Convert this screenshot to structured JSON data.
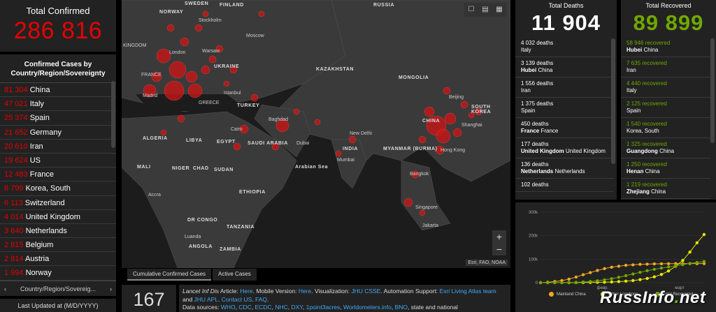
{
  "total_confirmed": {
    "label": "Total Confirmed",
    "value": "286 816"
  },
  "cases_list": {
    "header": "Confirmed Cases by Country/Region/Sovereignty",
    "items": [
      {
        "value": "81 304",
        "name": "China"
      },
      {
        "value": "47 021",
        "name": "Italy"
      },
      {
        "value": "25 374",
        "name": "Spain"
      },
      {
        "value": "21 652",
        "name": "Germany"
      },
      {
        "value": "20 610",
        "name": "Iran"
      },
      {
        "value": "19 624",
        "name": "US"
      },
      {
        "value": "12 483",
        "name": "France"
      },
      {
        "value": "8 799",
        "name": "Korea, South"
      },
      {
        "value": "6 113",
        "name": "Switzerland"
      },
      {
        "value": "4 014",
        "name": "United Kingdom"
      },
      {
        "value": "3 640",
        "name": "Netherlands"
      },
      {
        "value": "2 815",
        "name": "Belgium"
      },
      {
        "value": "2 814",
        "name": "Austria"
      },
      {
        "value": "1 994",
        "name": "Norway"
      }
    ],
    "footer": "Country/Region/Sovereig...",
    "prev_icon": "‹",
    "next_icon": "›"
  },
  "last_updated": "Last Updated at (M/D/YYYY)",
  "map": {
    "tools": [
      "☐",
      "▤",
      "▦"
    ],
    "zoom_in": "+",
    "zoom_out": "−",
    "attribution": "Esri, FAO, NOAA",
    "labels": [
      {
        "text": "SWEDEN"
      },
      {
        "text": "FINLAND"
      },
      {
        "text": "RUSSIA"
      },
      {
        "text": "NORWAY"
      },
      {
        "text": "UKRAINE"
      },
      {
        "text": "KAZAKHSTAN"
      },
      {
        "text": "MONGOLIA"
      },
      {
        "text": "TURKEY"
      },
      {
        "text": "CHINA"
      },
      {
        "text": "SOUTH KOREA"
      },
      {
        "text": "ALGERIA"
      },
      {
        "text": "LIBYA"
      },
      {
        "text": "EGYPT"
      },
      {
        "text": "SAUDI ARABIA"
      },
      {
        "text": "INDIA"
      },
      {
        "text": "MYANMAR (BURMA)"
      },
      {
        "text": "MALI"
      },
      {
        "text": "NIGER"
      },
      {
        "text": "CHAD"
      },
      {
        "text": "SUDAN"
      },
      {
        "text": "ETHIOPIA"
      },
      {
        "text": "DR CONGO"
      },
      {
        "text": "TANZANIA"
      },
      {
        "text": "ANGOLA"
      },
      {
        "text": "ZAMBIA"
      },
      {
        "text": "Arabian Sea"
      }
    ],
    "cities": [
      {
        "text": "Stockholm"
      },
      {
        "text": "Moscow"
      },
      {
        "text": "Warsaw"
      },
      {
        "text": "London"
      },
      {
        "text": "Madrid"
      },
      {
        "text": "Istanbul"
      },
      {
        "text": "Baghdad"
      },
      {
        "text": "Cairo"
      },
      {
        "text": "Dubai"
      },
      {
        "text": "New Delhi"
      },
      {
        "text": "Mumbai"
      },
      {
        "text": "Beijing"
      },
      {
        "text": "Shanghai"
      },
      {
        "text": "Hong Kong"
      },
      {
        "text": "Bangkok"
      },
      {
        "text": "Singapore"
      },
      {
        "text": "Jakarta"
      },
      {
        "text": "Accra"
      },
      {
        "text": "Luanda"
      },
      {
        "text": "KINGDOM"
      },
      {
        "text": "FRANCE"
      },
      {
        "text": "GREECE"
      }
    ]
  },
  "map_tabs": [
    "Cumulative Confirmed Cases",
    "Active Cases"
  ],
  "countries_count": "167",
  "info": {
    "line1_a": "Lancet Inf Dis",
    "line1_b": " Article: ",
    "here1": "Here",
    "line1_c": ". Mobile Version: ",
    "here2": "Here",
    "line1_d": ". Visualization: ",
    "jhu_csse": "JHU CSSE",
    "line1_e": ". Automation Support: ",
    "esri_team": "Esri Living Atlas team",
    "line2_a": " and ",
    "jhu_apl": "JHU APL",
    "line2_b": ". ",
    "contact": "Contact US",
    "line2_c": ". ",
    "faq": "FAQ",
    "line2_d": ".",
    "line3_a": "Data sources: ",
    "src_who": "WHO",
    "src_cdc": "CDC",
    "src_ecdc": "ECDC",
    "src_nhc": "NHC",
    "src_dxy": "DXY",
    "src_1p3": "1point3acres",
    "src_wm": "Worldometers.info",
    "src_bno": "BNO",
    "line3_b": ", state and national",
    "sep": ", "
  },
  "deaths": {
    "label": "Total Deaths",
    "value": "11 904",
    "items": [
      {
        "count": "4 032 deaths",
        "place_bold": "",
        "place": "Italy"
      },
      {
        "count": "3 139 deaths",
        "place_bold": "Hubei",
        "place": " China"
      },
      {
        "count": "1 556 deaths",
        "place_bold": "",
        "place": "Iran"
      },
      {
        "count": "1 375 deaths",
        "place_bold": "",
        "place": "Spain"
      },
      {
        "count": "450 deaths",
        "place_bold": "France",
        "place": " France"
      },
      {
        "count": "177 deaths",
        "place_bold": "United Kingdom",
        "place": " United Kingdom"
      },
      {
        "count": "136 deaths",
        "place_bold": "Netherlands",
        "place": " Netherlands"
      },
      {
        "count": "102 deaths",
        "place_bold": "",
        "place": ""
      }
    ]
  },
  "recovered": {
    "label": "Total Recovered",
    "value": "89 899",
    "items": [
      {
        "count": "58 946 recovered",
        "place_bold": "Hubei",
        "place": " China"
      },
      {
        "count": "7 635 recovered",
        "place_bold": "",
        "place": "Iran"
      },
      {
        "count": "4 440 recovered",
        "place_bold": "",
        "place": "Italy"
      },
      {
        "count": "2 125 recovered",
        "place_bold": "",
        "place": "Spain"
      },
      {
        "count": "1 540 recovered",
        "place_bold": "",
        "place": "Korea, South"
      },
      {
        "count": "1 325 recovered",
        "place_bold": "Guangdong",
        "place": " China"
      },
      {
        "count": "1 250 recovered",
        "place_bold": "Henan",
        "place": " China"
      },
      {
        "count": "1 219 recovered",
        "place_bold": "Zhejiang",
        "place": " China"
      }
    ]
  },
  "colors": {
    "confirmed": "#e60000",
    "recovered": "#70a800",
    "mainland": "#f5a623",
    "other": "#e6e600"
  },
  "chart_data": {
    "type": "line",
    "y_ticks": [
      "300k",
      "200k",
      "100k",
      "0"
    ],
    "x_ticks": [
      "февр.",
      "март"
    ],
    "ylim": [
      0,
      300000
    ],
    "series": [
      {
        "name": "Mainland China",
        "color": "#f5a623",
        "values": [
          0,
          2000,
          5000,
          9000,
          15000,
          24000,
          34000,
          43000,
          52000,
          60000,
          66000,
          70000,
          74000,
          76000,
          78000,
          79000,
          80000,
          80500,
          80800,
          81000,
          81100,
          81200,
          81250,
          81300
        ]
      },
      {
        "name": "Other Locations",
        "color": "#e6e600",
        "values": [
          0,
          0,
          100,
          200,
          300,
          500,
          700,
          1000,
          1500,
          2200,
          3000,
          4500,
          6500,
          9000,
          13000,
          18000,
          25000,
          35000,
          50000,
          70000,
          95000,
          130000,
          170000,
          205000
        ]
      },
      {
        "name": "Total Recovered",
        "color": "#70a800",
        "values": [
          0,
          0,
          100,
          300,
          800,
          1500,
          3000,
          5000,
          8000,
          12000,
          17000,
          23000,
          30000,
          37000,
          44000,
          51000,
          57000,
          62000,
          67000,
          72000,
          77000,
          82000,
          86000,
          89899
        ]
      }
    ]
  },
  "watermark": {
    "pre": "RussInfo",
    "dot": ".",
    "post": "net"
  }
}
